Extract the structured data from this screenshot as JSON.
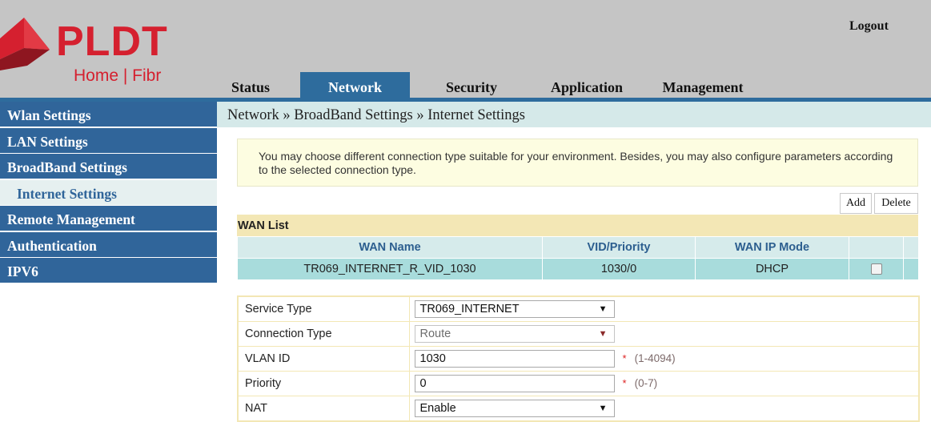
{
  "brand": {
    "logo_main": "PLDT",
    "logo_sub": "Home | Fibr",
    "logo_color": "#d5202f"
  },
  "header": {
    "logout_label": "Logout"
  },
  "top_tabs": [
    {
      "label": "Status",
      "active": false
    },
    {
      "label": "Network",
      "active": true
    },
    {
      "label": "Security",
      "active": false
    },
    {
      "label": "Application",
      "active": false
    },
    {
      "label": "Management",
      "active": false
    }
  ],
  "sidebar": {
    "items": [
      {
        "label": "Wlan Settings"
      },
      {
        "label": "LAN Settings"
      },
      {
        "label": "BroadBand Settings"
      },
      {
        "label": "Internet Settings",
        "sub": true,
        "selected": true
      },
      {
        "label": "Remote Management"
      },
      {
        "label": "Authentication"
      },
      {
        "label": "IPV6"
      }
    ]
  },
  "breadcrumb": "Network » BroadBand Settings » Internet Settings",
  "info_text": "You may choose different connection type suitable for your environment. Besides, you may also configure parameters according to the selected connection type.",
  "buttons": {
    "add": "Add",
    "delete": "Delete"
  },
  "wan_list": {
    "title": "WAN List",
    "columns": [
      "WAN Name",
      "VID/Priority",
      "WAN IP Mode"
    ],
    "rows": [
      {
        "name": "TR069_INTERNET_R_VID_1030",
        "vid_priority": "1030/0",
        "ip_mode": "DHCP",
        "checked": false
      }
    ]
  },
  "form": {
    "service_type": {
      "label": "Service Type",
      "value": "TR069_INTERNET"
    },
    "connection_type": {
      "label": "Connection Type",
      "value": "Route",
      "disabled": true
    },
    "vlan_id": {
      "label": "VLAN ID",
      "value": "1030",
      "required": "*",
      "hint": "(1-4094)"
    },
    "priority": {
      "label": "Priority",
      "value": "0",
      "required": "*",
      "hint": "(0-7)"
    },
    "nat": {
      "label": "NAT",
      "value": "Enable"
    }
  },
  "colors": {
    "header_bg": "#c5c5c5",
    "nav_blue": "#2e6c9d",
    "breadcrumb_bg": "#d5e9e9",
    "info_bg": "#fdfde1",
    "wan_title_bg": "#f3e7b5",
    "wan_header_bg": "#d6ebeb",
    "wan_row_bg": "#a8dcdc"
  }
}
